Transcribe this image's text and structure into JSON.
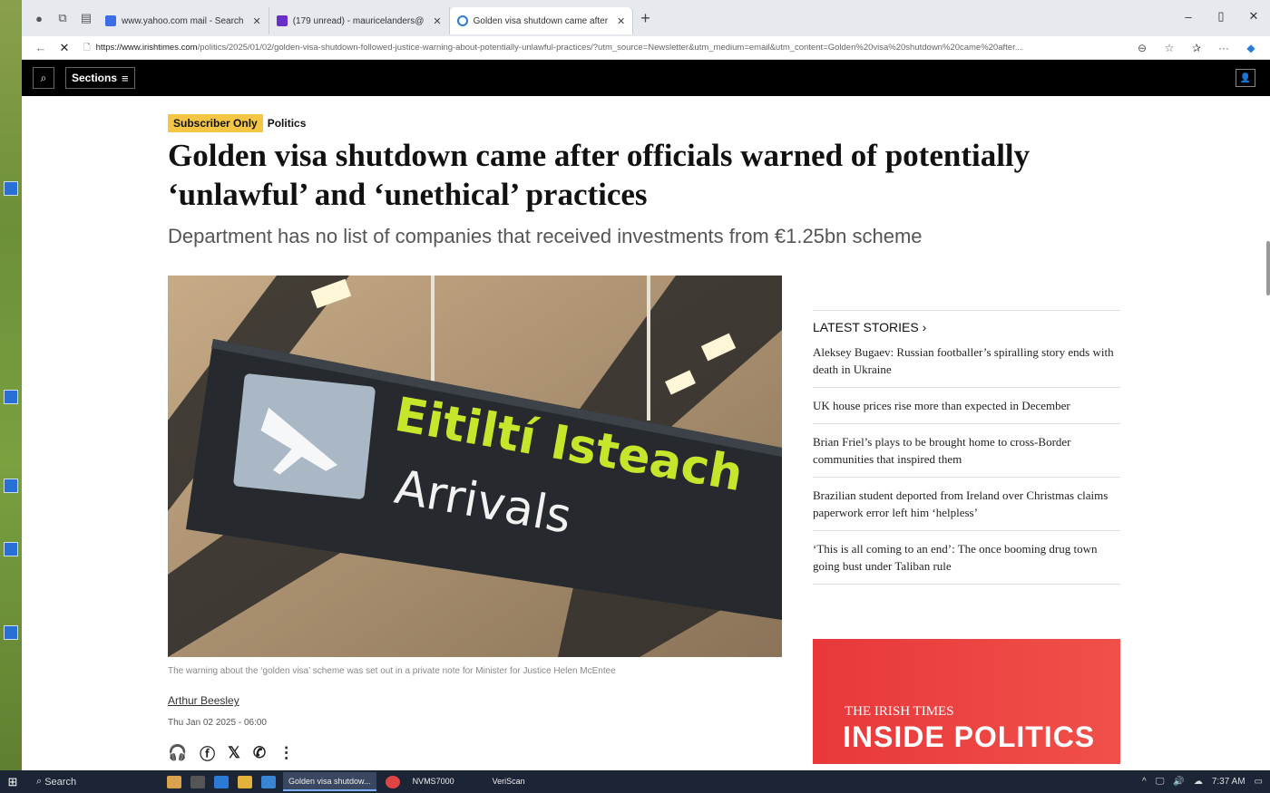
{
  "browser": {
    "tabs": [
      {
        "label": "www.yahoo.com mail - Search",
        "active": false
      },
      {
        "label": "(179 unread) - mauricelanders@",
        "active": false
      },
      {
        "label": "Golden visa shutdown came after",
        "active": true
      }
    ],
    "url_host": "https://www.irishtimes.com",
    "url_path": "/politics/2025/01/02/golden-visa-shutdown-followed-justice-warning-about-potentially-unlawful-practices/?utm_source=Newsletter&utm_medium=email&utm_content=Golden%20visa%20shutdown%20came%20after..."
  },
  "site": {
    "sections_label": "Sections"
  },
  "article": {
    "badge": "Subscriber Only",
    "category": "Politics",
    "headline_line1": "Golden visa shutdown came after officials warned of potentially",
    "headline_line2": "‘unlawful’ and ‘unethical’ practices",
    "standfirst": "Department has no list of companies that received investments from €1.25bn scheme",
    "image_sign_irish": "Eitiltí Isteach",
    "image_sign_english": "Arrivals",
    "caption": "The warning about the ‘golden visa’ scheme was set out in a private note for Minister for Justice Helen McEntee",
    "author": "Arthur Beesley",
    "date": "Thu Jan 02 2025 - 06:00"
  },
  "sidebar": {
    "latest_title": "LATEST STORIES",
    "stories": [
      "Aleksey Bugaev: Russian footballer’s spiralling story ends with death in Ukraine",
      "UK house prices rise more than expected in December",
      "Brian Friel’s plays to be brought home to cross-Border communities that inspired them",
      "Brazilian student deported from Ireland over Christmas claims paperwork error left him ‘helpless’",
      "‘This is all coming to an end’: The once booming drug town going bust under Taliban rule"
    ],
    "promo_brand": "THE IRISH TIMES",
    "promo_title": "INSIDE POLITICS"
  },
  "taskbar": {
    "search": "Search",
    "windows": [
      "Golden visa shutdow...",
      "NVMS7000",
      "VeriScan"
    ],
    "time": "7:37 AM"
  }
}
